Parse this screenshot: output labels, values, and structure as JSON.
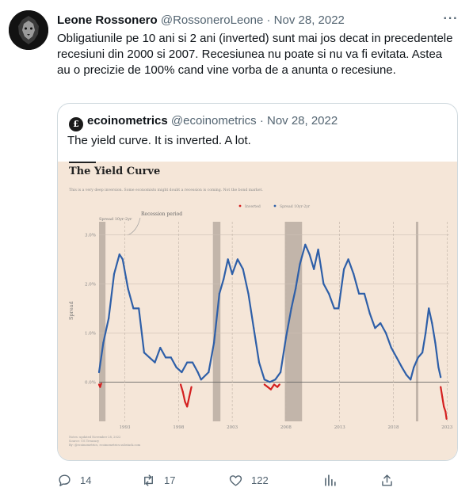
{
  "tweet": {
    "author_name": "Leone Rossonero",
    "handle_date": "@RossoneroLeone · Nov 28, 2022",
    "more_label": "···",
    "text": "Obligatiunile pe 10 ani si 2 ani (inverted) sunt mai jos decat in precedentele recesiuni din 2000 si 2007. Recesiunea nu poate si nu va fi evitata. Astea au o precizie de 100% cand vine vorba de a anunta o recesiune."
  },
  "quote": {
    "author_name": "ecoinometrics",
    "handle_date": "@ecoinometrics · Nov 28, 2022",
    "text": "The yield curve. It is inverted. A lot."
  },
  "chart_data": {
    "type": "line",
    "title": "The Yield Curve",
    "subtitle": "This is a very deep inversion. Some economists might doubt a recession is coming. Not the bond market.",
    "ylabel": "Spread",
    "xlabel": "",
    "legend_position": "top-right",
    "legend": [
      "Inverted",
      "Spread 10yr-2yr"
    ],
    "annotations": [
      "Spread 10yr-2yr",
      "Recession period"
    ],
    "y_ticks": [
      "3.0%",
      "2.0%",
      "1.0%",
      "0.0%"
    ],
    "x_ticks": [
      "1993",
      "1998",
      "2003",
      "2008",
      "2013",
      "2018",
      "2023"
    ],
    "ylim": [
      -0.8,
      3.2
    ],
    "xlim": [
      1990.6,
      2023.2
    ],
    "grid": true,
    "footnote": [
      "Notes: updated November 28, 2022",
      "Source: US Treasury",
      "By: @ecoinometrics, ecoinometrics.substack.com"
    ],
    "recessions": [
      [
        1990.6,
        1991.2
      ],
      [
        2001.2,
        2001.9
      ],
      [
        2007.9,
        2009.5
      ],
      [
        2020.1,
        2020.3
      ]
    ],
    "series": [
      {
        "name": "Spread 10yr-2yr",
        "color": "#2e5fa8",
        "points": [
          [
            1990.6,
            0.2
          ],
          [
            1991.0,
            0.8
          ],
          [
            1991.5,
            1.3
          ],
          [
            1992.0,
            2.2
          ],
          [
            1992.5,
            2.6
          ],
          [
            1992.8,
            2.5
          ],
          [
            1993.3,
            1.9
          ],
          [
            1993.8,
            1.5
          ],
          [
            1994.3,
            1.5
          ],
          [
            1994.8,
            0.6
          ],
          [
            1995.3,
            0.5
          ],
          [
            1995.8,
            0.4
          ],
          [
            1996.3,
            0.7
          ],
          [
            1996.8,
            0.5
          ],
          [
            1997.3,
            0.5
          ],
          [
            1997.8,
            0.3
          ],
          [
            1998.3,
            0.2
          ],
          [
            1998.8,
            0.4
          ],
          [
            1999.3,
            0.4
          ],
          [
            1999.8,
            0.2
          ],
          [
            2000.1,
            0.05
          ],
          [
            2000.8,
            0.2
          ],
          [
            2001.3,
            0.8
          ],
          [
            2001.8,
            1.8
          ],
          [
            2002.2,
            2.1
          ],
          [
            2002.6,
            2.5
          ],
          [
            2003.0,
            2.2
          ],
          [
            2003.5,
            2.5
          ],
          [
            2004.0,
            2.3
          ],
          [
            2004.5,
            1.8
          ],
          [
            2005.0,
            1.1
          ],
          [
            2005.5,
            0.4
          ],
          [
            2006.0,
            0.05
          ],
          [
            2006.5,
            0.0
          ],
          [
            2007.0,
            0.05
          ],
          [
            2007.5,
            0.2
          ],
          [
            2008.0,
            0.9
          ],
          [
            2008.5,
            1.5
          ],
          [
            2008.9,
            1.9
          ],
          [
            2009.3,
            2.4
          ],
          [
            2009.8,
            2.8
          ],
          [
            2010.2,
            2.6
          ],
          [
            2010.6,
            2.3
          ],
          [
            2011.0,
            2.7
          ],
          [
            2011.5,
            2.0
          ],
          [
            2012.0,
            1.8
          ],
          [
            2012.5,
            1.5
          ],
          [
            2012.9,
            1.5
          ],
          [
            2013.4,
            2.3
          ],
          [
            2013.8,
            2.5
          ],
          [
            2014.3,
            2.2
          ],
          [
            2014.8,
            1.8
          ],
          [
            2015.3,
            1.8
          ],
          [
            2015.8,
            1.4
          ],
          [
            2016.3,
            1.1
          ],
          [
            2016.8,
            1.2
          ],
          [
            2017.3,
            1.0
          ],
          [
            2017.8,
            0.7
          ],
          [
            2018.3,
            0.5
          ],
          [
            2018.8,
            0.3
          ],
          [
            2019.2,
            0.15
          ],
          [
            2019.6,
            0.05
          ],
          [
            2019.9,
            0.3
          ],
          [
            2020.3,
            0.5
          ],
          [
            2020.7,
            0.6
          ],
          [
            2021.0,
            1.0
          ],
          [
            2021.3,
            1.5
          ],
          [
            2021.6,
            1.2
          ],
          [
            2021.9,
            0.8
          ],
          [
            2022.2,
            0.3
          ],
          [
            2022.4,
            0.1
          ]
        ]
      },
      {
        "name": "Inverted",
        "color": "#d42020",
        "segments": [
          [
            [
              1990.6,
              -0.05
            ],
            [
              1990.7,
              -0.1
            ],
            [
              1990.8,
              -0.03
            ]
          ],
          [
            [
              1998.2,
              -0.05
            ],
            [
              1998.4,
              -0.2
            ],
            [
              1998.6,
              -0.4
            ],
            [
              1998.8,
              -0.5
            ],
            [
              1999.0,
              -0.3
            ],
            [
              1999.2,
              -0.1
            ]
          ],
          [
            [
              2006.0,
              -0.05
            ],
            [
              2006.3,
              -0.1
            ],
            [
              2006.6,
              -0.15
            ],
            [
              2006.9,
              -0.05
            ],
            [
              2007.2,
              -0.1
            ],
            [
              2007.4,
              -0.05
            ]
          ],
          [
            [
              2022.4,
              -0.1
            ],
            [
              2022.55,
              -0.3
            ],
            [
              2022.7,
              -0.5
            ],
            [
              2022.85,
              -0.6
            ],
            [
              2022.95,
              -0.75
            ]
          ]
        ]
      }
    ]
  },
  "actions": {
    "reply_count": "14",
    "retweet_count": "17",
    "like_count": "122"
  }
}
